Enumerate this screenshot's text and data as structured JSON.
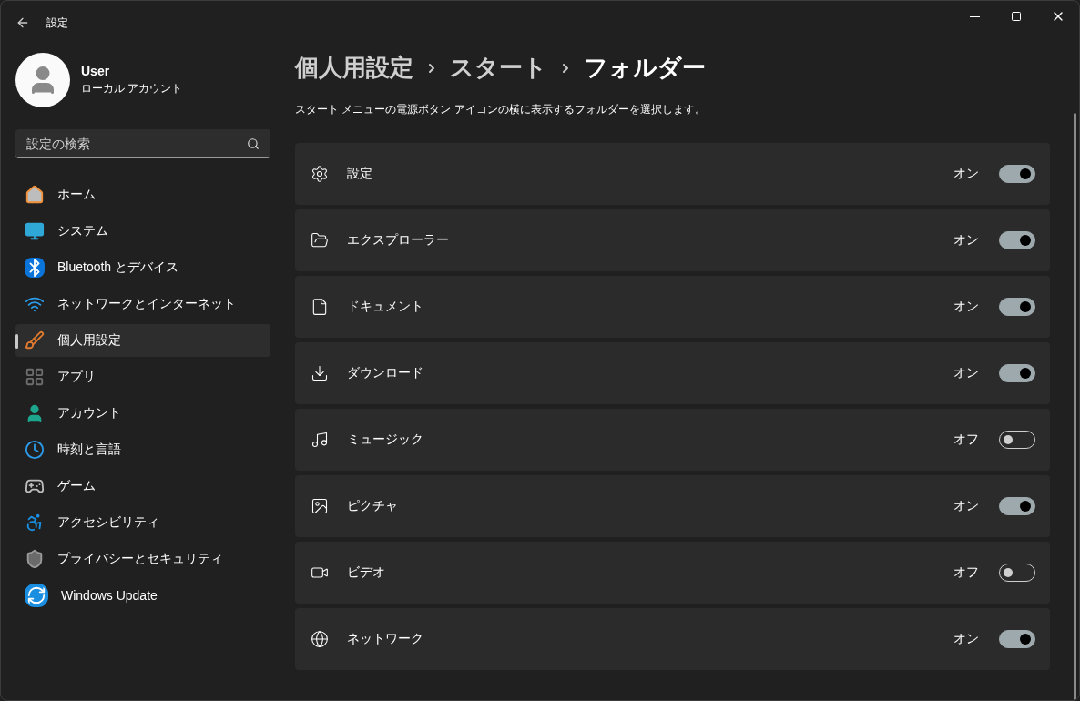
{
  "window": {
    "title": "設定"
  },
  "user": {
    "name": "User",
    "account_type": "ローカル アカウント"
  },
  "search": {
    "placeholder": "設定の検索"
  },
  "sidebar": {
    "items": [
      {
        "label": "ホーム",
        "selected": false
      },
      {
        "label": "システム",
        "selected": false
      },
      {
        "label": "Bluetooth とデバイス",
        "selected": false
      },
      {
        "label": "ネットワークとインターネット",
        "selected": false
      },
      {
        "label": "個人用設定",
        "selected": true
      },
      {
        "label": "アプリ",
        "selected": false
      },
      {
        "label": "アカウント",
        "selected": false
      },
      {
        "label": "時刻と言語",
        "selected": false
      },
      {
        "label": "ゲーム",
        "selected": false
      },
      {
        "label": "アクセシビリティ",
        "selected": false
      },
      {
        "label": "プライバシーとセキュリティ",
        "selected": false
      },
      {
        "label": "Windows Update",
        "selected": false
      }
    ]
  },
  "breadcrumb": [
    "個人用設定",
    "スタート",
    "フォルダー"
  ],
  "description": "スタート メニューの電源ボタン アイコンの横に表示するフォルダーを選択します。",
  "folders": [
    {
      "label": "設定",
      "on": true,
      "state_label": "オン"
    },
    {
      "label": "エクスプローラー",
      "on": true,
      "state_label": "オン"
    },
    {
      "label": "ドキュメント",
      "on": true,
      "state_label": "オン"
    },
    {
      "label": "ダウンロード",
      "on": true,
      "state_label": "オン"
    },
    {
      "label": "ミュージック",
      "on": false,
      "state_label": "オフ"
    },
    {
      "label": "ピクチャ",
      "on": true,
      "state_label": "オン"
    },
    {
      "label": "ビデオ",
      "on": false,
      "state_label": "オフ"
    },
    {
      "label": "ネットワーク",
      "on": true,
      "state_label": "オン"
    }
  ]
}
